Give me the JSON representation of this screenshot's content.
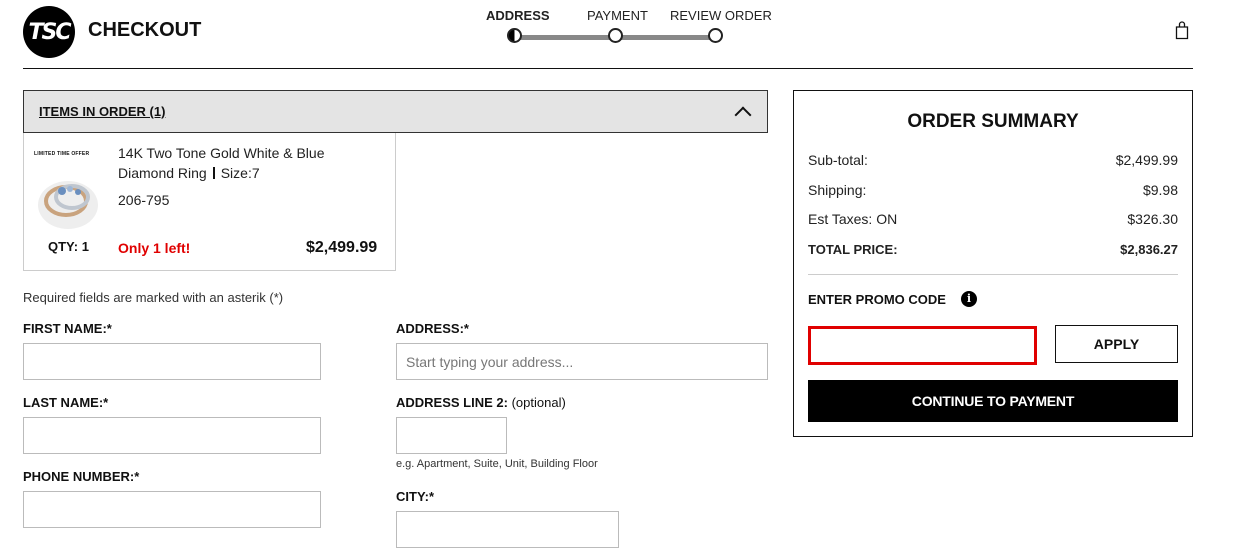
{
  "header": {
    "logo_text": "TSC",
    "title": "CHECKOUT",
    "steps": [
      {
        "label": "ADDRESS",
        "state": "active"
      },
      {
        "label": "PAYMENT",
        "state": "upcoming"
      },
      {
        "label": "REVIEW ORDER",
        "state": "upcoming"
      }
    ],
    "bag_icon": "shopping-bag-icon"
  },
  "items_panel": {
    "heading": "ITEMS IN ORDER (1)",
    "toggle_icon": "chevron-up-icon",
    "item": {
      "badge": "LIMITED TIME OFFER",
      "name": "14K Two Tone Gold White & Blue Diamond Ring",
      "size": "Size:7",
      "sku": "206-795",
      "qty": "QTY: 1",
      "stock_note": "Only 1 left!",
      "price": "$2,499.99"
    }
  },
  "form": {
    "required_note": "Required fields are marked with an asterik (*)",
    "first_name": {
      "label": "FIRST NAME:*",
      "value": "",
      "placeholder": ""
    },
    "last_name": {
      "label": "LAST NAME:*",
      "value": "",
      "placeholder": ""
    },
    "phone": {
      "label": "PHONE NUMBER:*",
      "value": "",
      "placeholder": ""
    },
    "address": {
      "label": "ADDRESS:*",
      "value": "",
      "placeholder": "Start typing your address..."
    },
    "address2": {
      "label": "ADDRESS LINE 2:",
      "optional": "(optional)",
      "value": "",
      "placeholder": "",
      "hint": "e.g. Apartment, Suite, Unit, Building Floor"
    },
    "city": {
      "label": "CITY:*",
      "value": "",
      "placeholder": ""
    }
  },
  "summary": {
    "title": "ORDER SUMMARY",
    "rows": [
      {
        "label": "Sub-total:",
        "value": "$2,499.99"
      },
      {
        "label": "Shipping:",
        "value": "$9.98"
      },
      {
        "label": "Est Taxes: ON",
        "value": "$326.30"
      }
    ],
    "total": {
      "label": "TOTAL PRICE:",
      "value": "$2,836.27"
    },
    "promo_label": "ENTER PROMO CODE",
    "info_icon": "info-icon",
    "promo_value": "",
    "apply_label": "APPLY",
    "continue_label": "CONTINUE TO PAYMENT"
  },
  "colors": {
    "accent_red": "#e00000",
    "header_gray": "#e4e4e4",
    "black": "#000000"
  }
}
